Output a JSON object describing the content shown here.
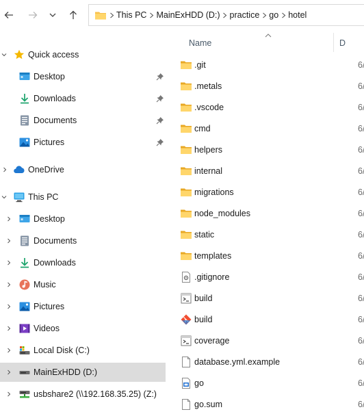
{
  "address": {
    "crumbs": [
      "This PC",
      "MainExHDD (D:)",
      "practice",
      "go",
      "hotel"
    ]
  },
  "sidebar": {
    "quick_access": {
      "label": "Quick access",
      "items": [
        {
          "label": "Desktop",
          "icon": "desktop-icon",
          "pinned": true
        },
        {
          "label": "Downloads",
          "icon": "downloads-icon",
          "pinned": true
        },
        {
          "label": "Documents",
          "icon": "documents-icon",
          "pinned": true
        },
        {
          "label": "Pictures",
          "icon": "pictures-icon",
          "pinned": true
        }
      ]
    },
    "onedrive": {
      "label": "OneDrive"
    },
    "this_pc": {
      "label": "This PC",
      "items": [
        {
          "label": "Desktop",
          "icon": "desktop-icon"
        },
        {
          "label": "Documents",
          "icon": "documents-icon"
        },
        {
          "label": "Downloads",
          "icon": "downloads-icon"
        },
        {
          "label": "Music",
          "icon": "music-icon"
        },
        {
          "label": "Pictures",
          "icon": "pictures-icon"
        },
        {
          "label": "Videos",
          "icon": "videos-icon"
        },
        {
          "label": "Local Disk (C:)",
          "icon": "local-disk-icon"
        },
        {
          "label": "MainExHDD (D:)",
          "icon": "drive-icon",
          "selected": true
        },
        {
          "label": "usbshare2 (\\\\192.168.35.25) (Z:)",
          "icon": "network-drive-icon"
        }
      ]
    }
  },
  "columns": {
    "name": "Name",
    "date": "D"
  },
  "files": [
    {
      "name": ".git",
      "icon": "folder-icon",
      "date": "6/"
    },
    {
      "name": ".metals",
      "icon": "folder-icon",
      "date": "6/"
    },
    {
      "name": ".vscode",
      "icon": "folder-icon",
      "date": "6/"
    },
    {
      "name": "cmd",
      "icon": "folder-icon",
      "date": "6/"
    },
    {
      "name": "helpers",
      "icon": "folder-icon",
      "date": "6/"
    },
    {
      "name": "internal",
      "icon": "folder-icon",
      "date": "6/"
    },
    {
      "name": "migrations",
      "icon": "folder-icon",
      "date": "6/"
    },
    {
      "name": "node_modules",
      "icon": "folder-icon",
      "date": "6/"
    },
    {
      "name": "static",
      "icon": "folder-icon",
      "date": "6/"
    },
    {
      "name": "templates",
      "icon": "folder-icon",
      "date": "6/"
    },
    {
      "name": ".gitignore",
      "icon": "config-file-icon",
      "date": "6/"
    },
    {
      "name": "build",
      "icon": "script-file-icon",
      "date": "6/"
    },
    {
      "name": "build",
      "icon": "git-file-icon",
      "date": "6/"
    },
    {
      "name": "coverage",
      "icon": "script-file-icon",
      "date": "6/"
    },
    {
      "name": "database.yml.example",
      "icon": "blank-file-icon",
      "date": "6/"
    },
    {
      "name": "go",
      "icon": "go-file-icon",
      "date": "6/"
    },
    {
      "name": "go.sum",
      "icon": "blank-file-icon",
      "date": "6/"
    }
  ],
  "colors": {
    "accent": "#0078d4",
    "folder": "#f8c04c",
    "selected_bg": "#dcdcdc"
  }
}
